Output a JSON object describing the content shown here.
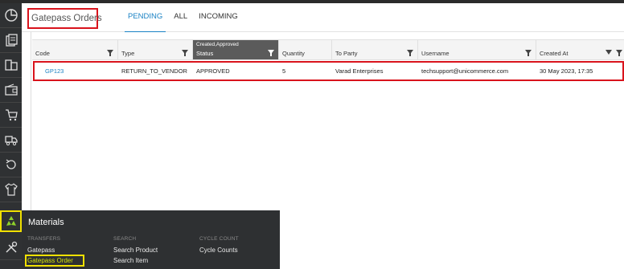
{
  "header": {
    "title": "Gatepass Orders",
    "tabs": [
      {
        "label": "PENDING",
        "active": true
      },
      {
        "label": "ALL",
        "active": false
      },
      {
        "label": "INCOMING",
        "active": false
      }
    ]
  },
  "sidebar": {
    "icons": [
      "dashboard-icon",
      "orders-icon",
      "products-icon",
      "wallet-icon",
      "cart-icon",
      "truck-icon",
      "returns-icon",
      "shirt-icon",
      "materials-icon",
      "tools-icon"
    ]
  },
  "table": {
    "columns": [
      {
        "label": "Code",
        "sublabel": ""
      },
      {
        "label": "Type",
        "sublabel": ""
      },
      {
        "label": "Status",
        "sublabel": "Created,Approved"
      },
      {
        "label": "Quantity",
        "sublabel": ""
      },
      {
        "label": "To Party",
        "sublabel": ""
      },
      {
        "label": "Username",
        "sublabel": ""
      },
      {
        "label": "Created At",
        "sublabel": ""
      }
    ],
    "rows": [
      {
        "code": "GP123",
        "type": "RETURN_TO_VENDOR",
        "status": "APPROVED",
        "quantity": "5",
        "to_party": "Varad Enterprises",
        "username": "techsupport@unicommerce.com",
        "created_at": "30 May 2023, 17:35"
      }
    ]
  },
  "materials_menu": {
    "title": "Materials",
    "sections": [
      {
        "heading": "TRANSFERS",
        "items": [
          "Gatepass",
          "Gatepass Order"
        ]
      },
      {
        "heading": "SEARCH",
        "items": [
          "Search Product",
          "Search Item"
        ]
      },
      {
        "heading": "CYCLE COUNT",
        "items": [
          "Cycle Counts"
        ]
      }
    ],
    "selected_item": "Gatepass Order"
  },
  "colors": {
    "accent": "#1a82c4",
    "highlight_red": "#d9131c",
    "highlight_yellow": "#f0e000",
    "sidebar_bg": "#2f3133",
    "selected_menu_text": "#d4e10a"
  }
}
